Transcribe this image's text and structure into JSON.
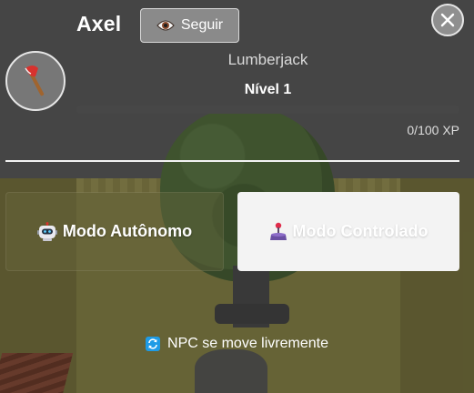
{
  "npc": {
    "name": "Axel",
    "profession": "Lumberjack",
    "level_label": "Nível 1",
    "xp_label": "0/100 XP",
    "xp_progress": 0,
    "avatar_icon": "axe-icon"
  },
  "header": {
    "follow_label": "Seguir",
    "follow_icon": "eye-icon",
    "close_icon": "close-icon"
  },
  "modes": {
    "autonomous_label": "Modo Autônomo",
    "autonomous_icon": "robot-icon",
    "controlled_label": "Modo Controlado",
    "controlled_icon": "joystick-icon",
    "active": "autonomous"
  },
  "status": {
    "text": "NPC se move livremente",
    "icon": "refresh-icon"
  },
  "colors": {
    "xp_fill": "#f0c238",
    "accent_blue": "#1e9be6",
    "axe_red": "#d8322e"
  }
}
